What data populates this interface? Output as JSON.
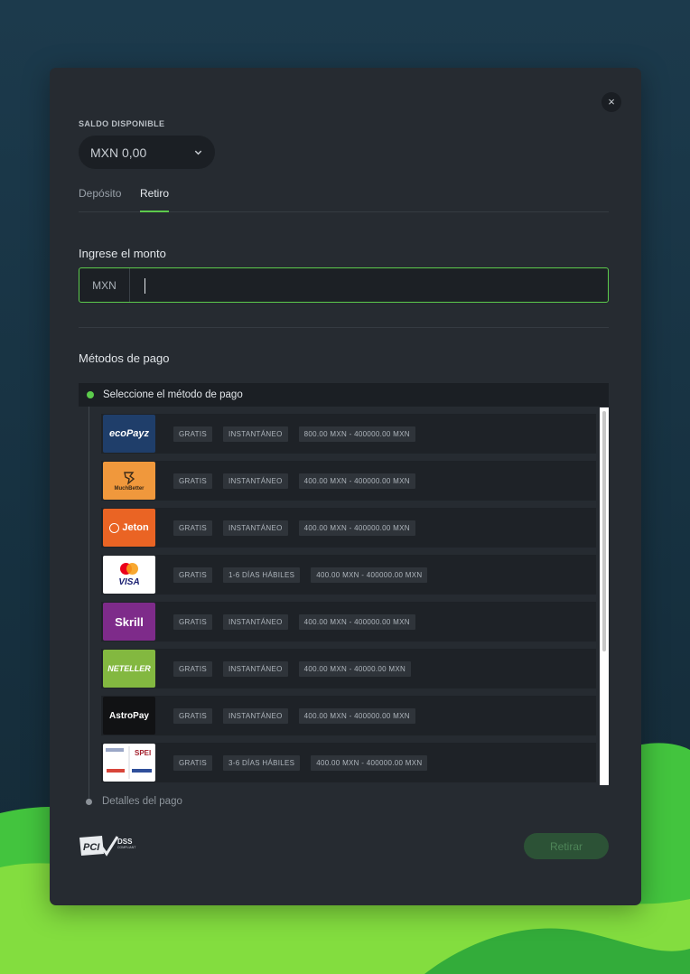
{
  "modal": {
    "close_symbol": "×",
    "balance": {
      "label": "SALDO DISPONIBLE",
      "value": "MXN 0,00"
    },
    "tabs": [
      {
        "label": "Depósito",
        "active": false
      },
      {
        "label": "Retiro",
        "active": true
      }
    ],
    "amount": {
      "label": "Ingrese el monto",
      "currency": "MXN",
      "value": ""
    },
    "methods_label": "Métodos de pago",
    "step1_label": "Seleccione el método de pago",
    "step2_label": "Detalles del pago",
    "submit_label": "Retirar",
    "pci": {
      "left": "PCI",
      "right": "DSS",
      "sub": "COMPLIANT"
    }
  },
  "payment_methods": [
    {
      "name": "ecoPayz",
      "logo_text": "ecoPayz",
      "badges": [
        "GRATIS",
        "INSTANTÁNEO",
        "800.00 MXN - 400000.00 MXN"
      ]
    },
    {
      "name": "MuchBetter",
      "logo_text": "MuchBetter",
      "badges": [
        "GRATIS",
        "INSTANTÁNEO",
        "400.00 MXN - 400000.00 MXN"
      ]
    },
    {
      "name": "Jeton",
      "logo_text": "Jeton",
      "badges": [
        "GRATIS",
        "INSTANTÁNEO",
        "400.00 MXN - 400000.00 MXN"
      ]
    },
    {
      "name": "Visa",
      "logo_text": "VISA",
      "badges": [
        "GRATIS",
        "1-6 DÍAS HÁBILES",
        "400.00 MXN - 400000.00 MXN"
      ]
    },
    {
      "name": "Skrill",
      "logo_text": "Skrill",
      "badges": [
        "GRATIS",
        "INSTANTÁNEO",
        "400.00 MXN - 400000.00 MXN"
      ]
    },
    {
      "name": "Neteller",
      "logo_text": "NETELLER",
      "badges": [
        "GRATIS",
        "INSTANTÁNEO",
        "400.00 MXN - 40000.00 MXN"
      ]
    },
    {
      "name": "AstroPay",
      "logo_text": "AstroPay",
      "badges": [
        "GRATIS",
        "INSTANTÁNEO",
        "400.00 MXN - 400000.00 MXN"
      ]
    },
    {
      "name": "SPEI",
      "logo_text": "SPEI",
      "badges": [
        "GRATIS",
        "3-6 DÍAS HÁBILES",
        "400.00 MXN - 400000.00 MXN"
      ]
    }
  ],
  "colors": {
    "accent": "#5ccb4c",
    "panel": "#262b31",
    "row": "#1e2227",
    "badge": "#2f343a"
  }
}
